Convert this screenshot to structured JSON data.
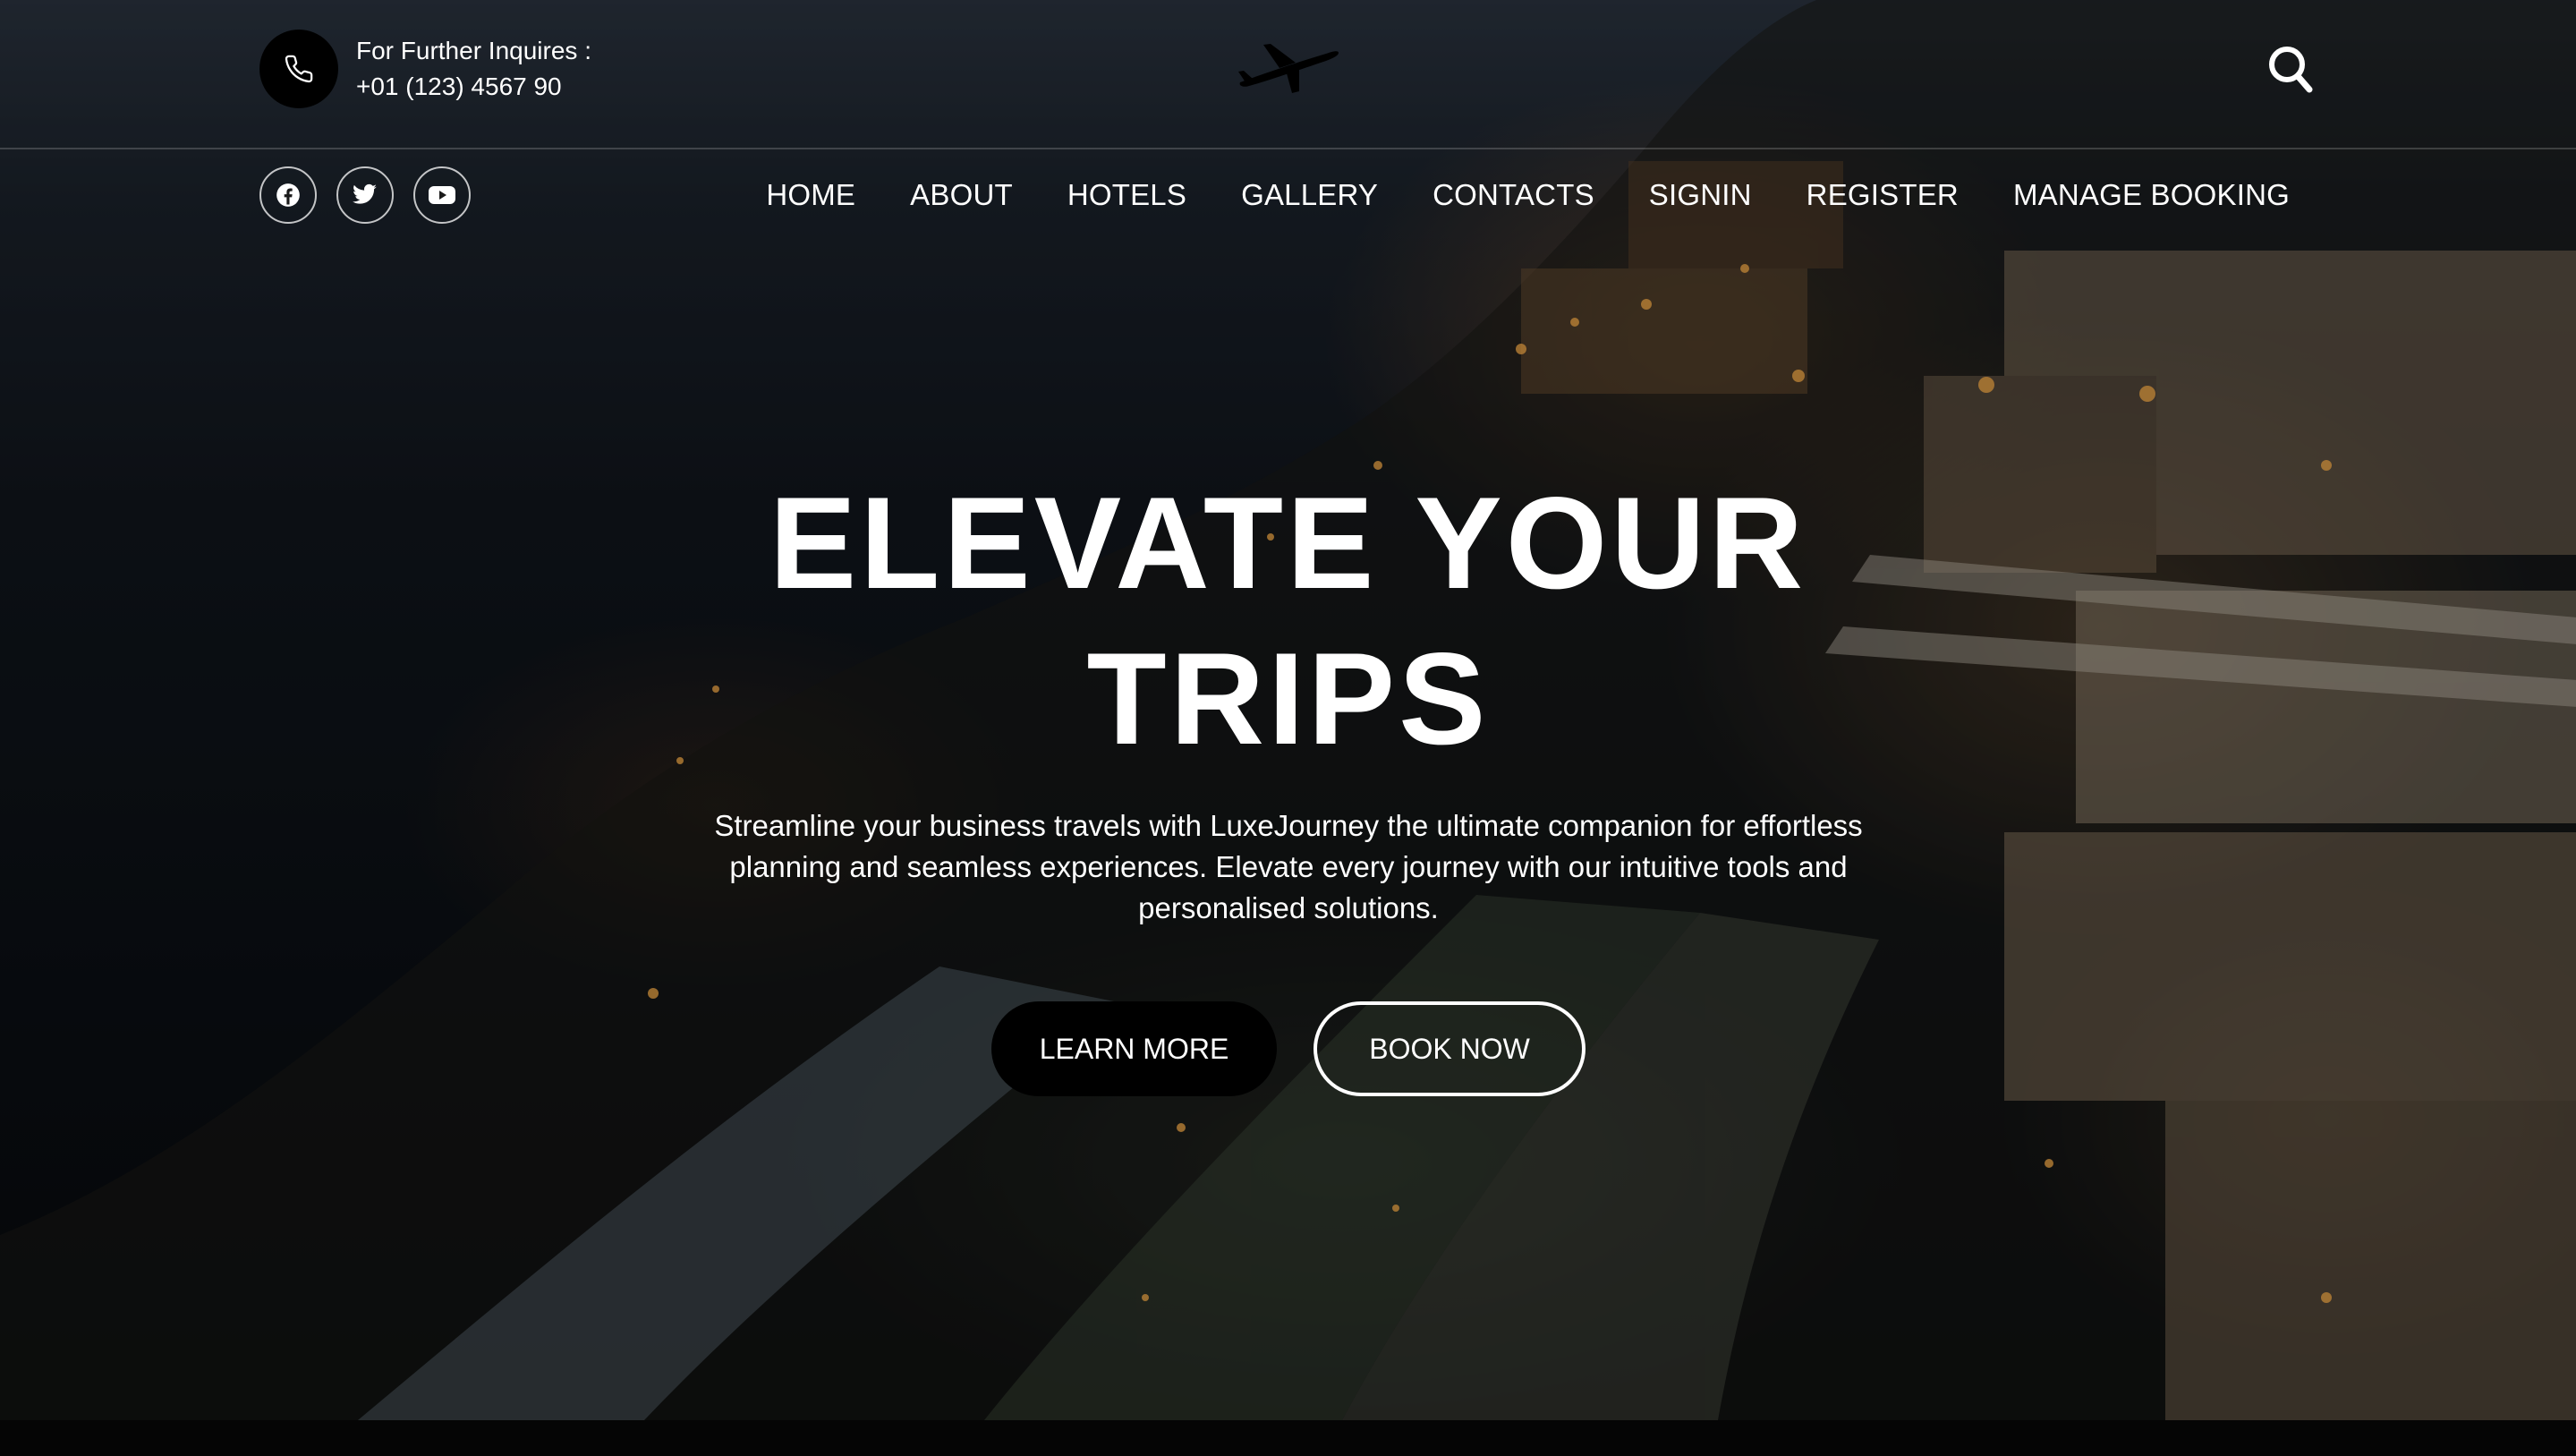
{
  "header": {
    "contact_label": "For Further Inquires :",
    "contact_phone": "+01 (123) 4567 90",
    "phone_icon": "phone-icon",
    "logo_icon": "airplane-icon",
    "search_icon": "search-icon"
  },
  "social": [
    {
      "icon": "facebook-icon"
    },
    {
      "icon": "twitter-icon"
    },
    {
      "icon": "youtube-icon"
    }
  ],
  "nav": {
    "items": [
      {
        "label": "HOME"
      },
      {
        "label": "ABOUT"
      },
      {
        "label": "HOTELS"
      },
      {
        "label": "GALLERY"
      },
      {
        "label": "CONTACTS"
      },
      {
        "label": "SIGNIN"
      },
      {
        "label": "REGISTER"
      },
      {
        "label": "MANAGE BOOKING"
      }
    ]
  },
  "hero": {
    "headline_line1": "ELEVATE YOUR",
    "headline_line2": "TRIPS",
    "description": "Streamline your business travels with LuxeJourney the ultimate companion for effortless planning and seamless experiences. Elevate every journey with our intuitive tools and personalised solutions.",
    "learn_more_label": "LEARN MORE",
    "book_now_label": "BOOK NOW"
  },
  "colors": {
    "text": "#ffffff",
    "button_dark": "#000000",
    "outline": "#ffffff"
  }
}
